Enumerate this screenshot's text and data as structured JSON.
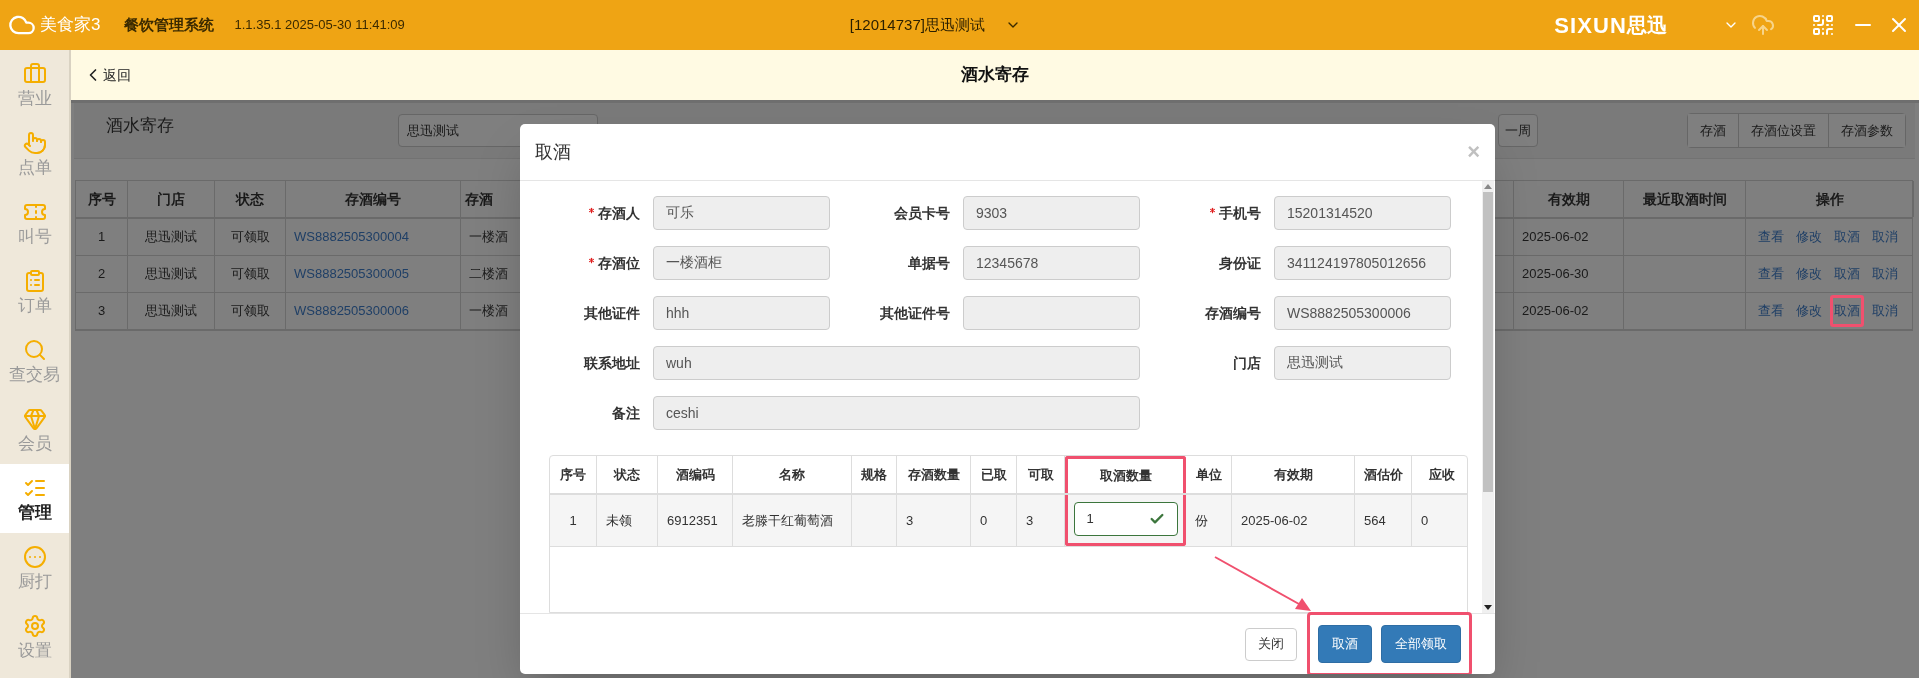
{
  "topbar": {
    "logo": "美食家3",
    "app_name": "餐饮管理系统",
    "version": "1.1.35.1 2025-05-30 11:41:09",
    "store": "[12014737]思迅测试",
    "brand_latin": "SIXUN",
    "brand_cn": "思迅"
  },
  "subheader": {
    "back": "返回",
    "title": "酒水寄存"
  },
  "sidebar": [
    {
      "label": "营业",
      "selected": false
    },
    {
      "label": "点单",
      "selected": false
    },
    {
      "label": "叫号",
      "selected": false
    },
    {
      "label": "订单",
      "selected": false
    },
    {
      "label": "查交易",
      "selected": false
    },
    {
      "label": "会员",
      "selected": false
    },
    {
      "label": "管理",
      "selected": true
    },
    {
      "label": "厨打",
      "selected": false
    },
    {
      "label": "设置",
      "selected": false
    }
  ],
  "page": {
    "title": "酒水寄存",
    "store_filter": "思迅测试",
    "range_button": "一周",
    "actions": [
      "存酒",
      "存酒位设置",
      "存酒参数"
    ]
  },
  "table": {
    "columns": [
      "序号",
      "门店",
      "状态",
      "存酒编号",
      "存酒",
      "有效期",
      "最近取酒时间",
      "操作"
    ],
    "rows": [
      {
        "cells": [
          "1",
          "思迅测试",
          "可领取",
          "WS8882505300004",
          "一楼酒",
          "2025-06-02",
          ""
        ],
        "actions": [
          {
            "label": "查看",
            "highlighted": false
          },
          {
            "label": "修改",
            "highlighted": false
          },
          {
            "label": "取酒",
            "highlighted": false
          },
          {
            "label": "取消",
            "highlighted": false
          }
        ]
      },
      {
        "cells": [
          "2",
          "思迅测试",
          "可领取",
          "WS8882505300005",
          "二楼酒",
          "2025-06-30",
          ""
        ],
        "actions": [
          {
            "label": "查看",
            "highlighted": false
          },
          {
            "label": "修改",
            "highlighted": false
          },
          {
            "label": "取酒",
            "highlighted": false
          },
          {
            "label": "取消",
            "highlighted": false
          }
        ]
      },
      {
        "cells": [
          "3",
          "思迅测试",
          "可领取",
          "WS8882505300006",
          "一楼酒",
          "2025-06-02",
          ""
        ],
        "actions": [
          {
            "label": "查看",
            "highlighted": false
          },
          {
            "label": "修改",
            "highlighted": false
          },
          {
            "label": "取酒",
            "highlighted": true
          },
          {
            "label": "取消",
            "highlighted": false
          }
        ]
      }
    ]
  },
  "dialog": {
    "title": "取酒",
    "close": "×",
    "fields": [
      {
        "label": "存酒人",
        "value": "可乐",
        "required": true,
        "kind": "short"
      },
      {
        "label": "会员卡号",
        "value": "9303",
        "required": false,
        "kind": "short"
      },
      {
        "label": "手机号",
        "value": "15201314520",
        "required": true,
        "kind": "short"
      },
      {
        "label": "存酒位",
        "value": "一楼酒柜",
        "required": true,
        "kind": "short"
      },
      {
        "label": "单据号",
        "value": "12345678",
        "required": false,
        "kind": "short"
      },
      {
        "label": "身份证",
        "value": "341124197805012656",
        "required": false,
        "kind": "short"
      },
      {
        "label": "其他证件",
        "value": "hhh",
        "required": false,
        "kind": "short"
      },
      {
        "label": "其他证件号",
        "required": false,
        "kind": "short"
      },
      {
        "label": "存酒编号",
        "value": "WS8882505300006",
        "required": false,
        "kind": "short"
      },
      {
        "label": "联系地址",
        "value": "wuh",
        "required": false,
        "kind": "wide"
      },
      {
        "label": "门店",
        "value": "思迅测试",
        "required": false,
        "kind": "short"
      },
      {
        "label": "备注",
        "value": "ceshi",
        "required": false,
        "kind": "wide"
      }
    ],
    "table": {
      "columns": [
        {
          "label": "序号",
          "highlighted": false
        },
        {
          "label": "状态",
          "highlighted": false
        },
        {
          "label": "酒编码",
          "highlighted": false
        },
        {
          "label": "名称",
          "highlighted": false
        },
        {
          "label": "规格",
          "highlighted": false
        },
        {
          "label": "存酒数量",
          "highlighted": false
        },
        {
          "label": "已取",
          "highlighted": false
        },
        {
          "label": "可取",
          "highlighted": false
        },
        {
          "label": "取酒数量",
          "highlighted": true
        },
        {
          "label": "单位",
          "highlighted": false
        },
        {
          "label": "有效期",
          "highlighted": false
        },
        {
          "label": "酒估价",
          "highlighted": false
        },
        {
          "label": "应收",
          "highlighted": false
        }
      ],
      "rows": [
        {
          "cells": [
            "1",
            "未领",
            "6912351",
            "老滕干红葡萄酒",
            "",
            "3",
            "0",
            "3",
            "1",
            "份",
            "2025-06-02",
            "564",
            "0"
          ],
          "quantity_valid": true
        }
      ]
    },
    "buttons": [
      {
        "label": "关闭",
        "kind": "default"
      },
      {
        "label": "取酒",
        "kind": "primary"
      },
      {
        "label": "全部领取",
        "kind": "primary"
      }
    ],
    "buttons_highlighted": true
  }
}
